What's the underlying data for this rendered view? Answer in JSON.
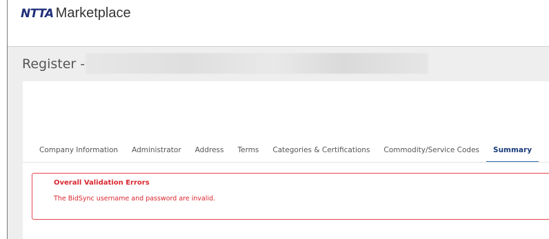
{
  "header": {
    "brand_logo": "NTTA",
    "brand_name": "Marketplace"
  },
  "page": {
    "title": "Register -"
  },
  "tabs": [
    {
      "label": "Company Information",
      "active": false
    },
    {
      "label": "Administrator",
      "active": false
    },
    {
      "label": "Address",
      "active": false
    },
    {
      "label": "Terms",
      "active": false
    },
    {
      "label": "Categories & Certifications",
      "active": false
    },
    {
      "label": "Commodity/Service Codes",
      "active": false
    },
    {
      "label": "Summary",
      "active": true
    }
  ],
  "validation": {
    "title": "Overall Validation Errors",
    "message": "The BidSync username and password are invalid."
  },
  "colors": {
    "brand_logo": "#1f2f7a",
    "active_tab": "#1a3c7a",
    "active_tab_underline": "#2c6fab",
    "error": "#d9262f"
  }
}
